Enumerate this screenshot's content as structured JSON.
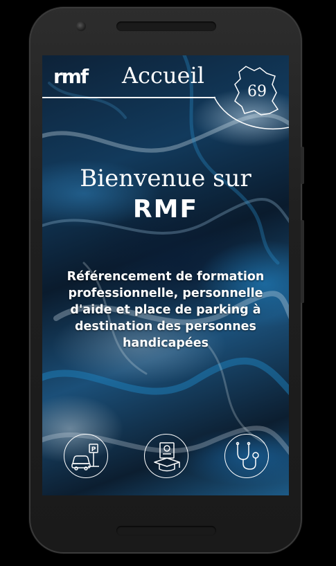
{
  "header": {
    "logo": "rmf",
    "title": "Accueil",
    "region_number": "69"
  },
  "hero": {
    "welcome": "Bienvenue sur",
    "brand": "RMF",
    "description": "Référencement de formation professionnelle, personnelle d'aide et place de parking à destination des personnes handicapées"
  },
  "nav": {
    "items": [
      {
        "icon": "car-parking-icon",
        "sign": "P"
      },
      {
        "icon": "graduation-diploma-icon"
      },
      {
        "icon": "stethoscope-icon"
      }
    ]
  },
  "colors": {
    "text": "#ffffff",
    "screen_base": "#0d2238",
    "accent_blue": "#1d5a86"
  }
}
